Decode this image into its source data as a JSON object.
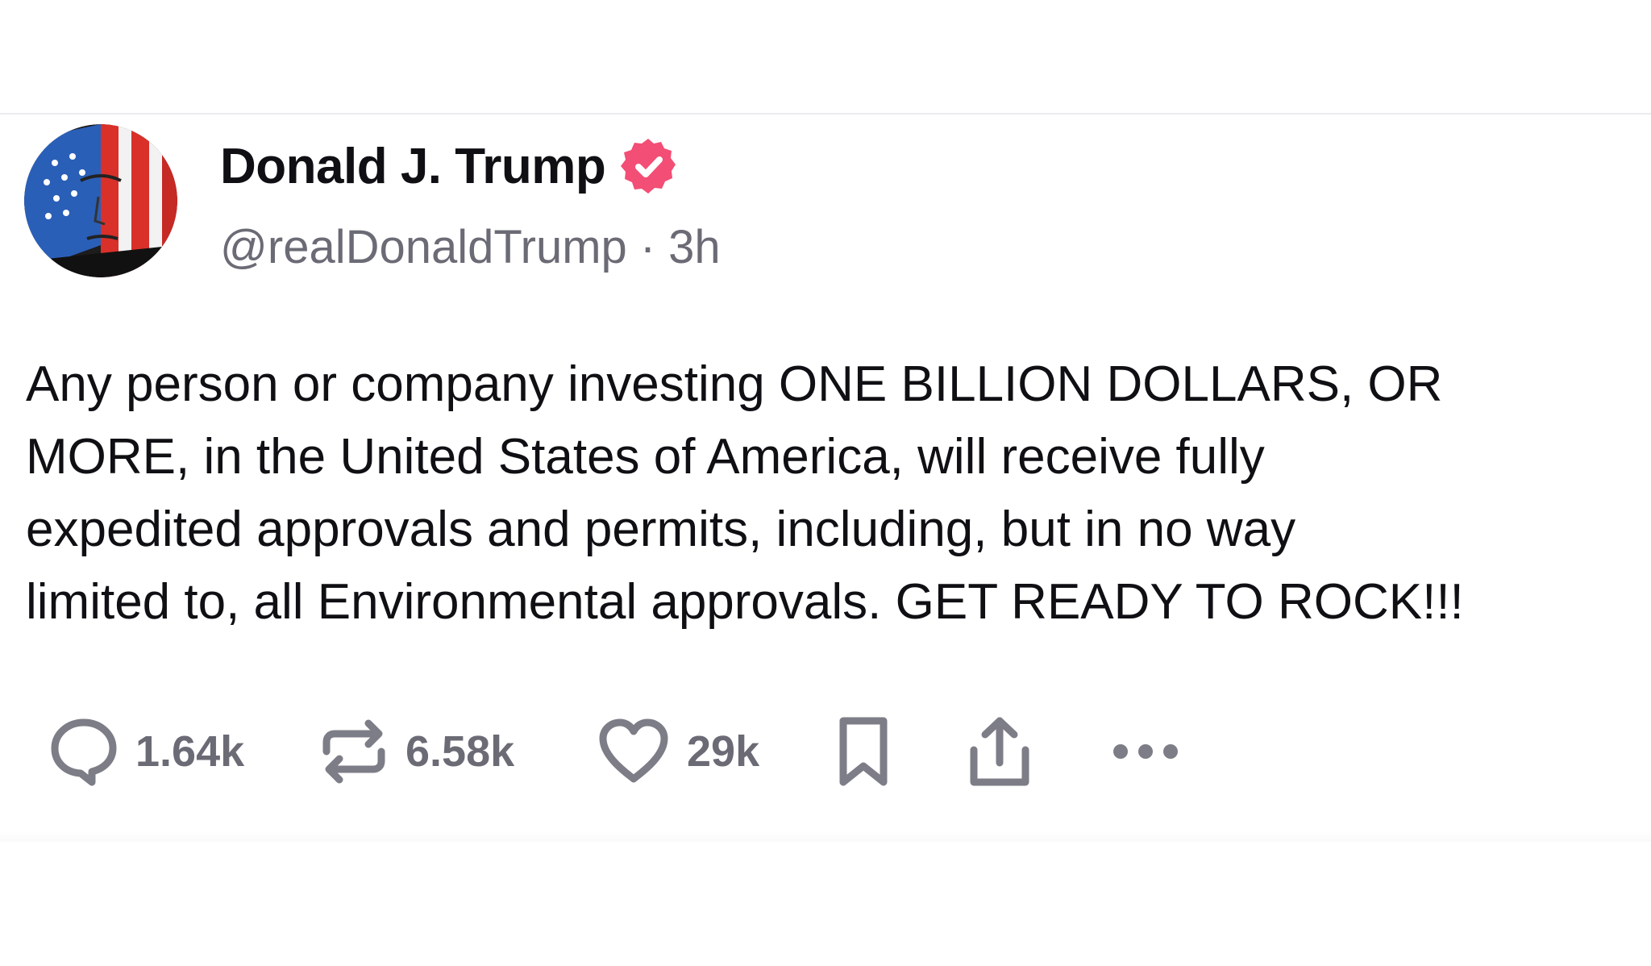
{
  "post": {
    "author": {
      "display_name": "Donald J. Trump",
      "handle": "@realDonaldTrump",
      "separator": "·",
      "timestamp": "3h",
      "verified_icon": "verified-badge-icon",
      "badge_color": "#f34e75"
    },
    "text_lines": [
      "Any person or company investing ONE BILLION DOLLARS, OR",
      "MORE, in the United States of America, will receive fully",
      "expedited approvals and permits, including, but in no way",
      "limited to, all Environmental approvals. GET READY TO ROCK!!!"
    ],
    "actions": {
      "reply": {
        "icon": "comment-icon",
        "count": "1.64k"
      },
      "repost": {
        "icon": "repost-icon",
        "count": "6.58k"
      },
      "like": {
        "icon": "heart-icon",
        "count": "29k"
      },
      "bookmark": {
        "icon": "bookmark-icon"
      },
      "share": {
        "icon": "share-icon"
      },
      "more": {
        "icon": "more-dots-icon"
      }
    }
  },
  "colors": {
    "text": "#0f0f14",
    "muted": "#6b6b76",
    "icon": "#7d7d87",
    "divider": "#ececef"
  }
}
